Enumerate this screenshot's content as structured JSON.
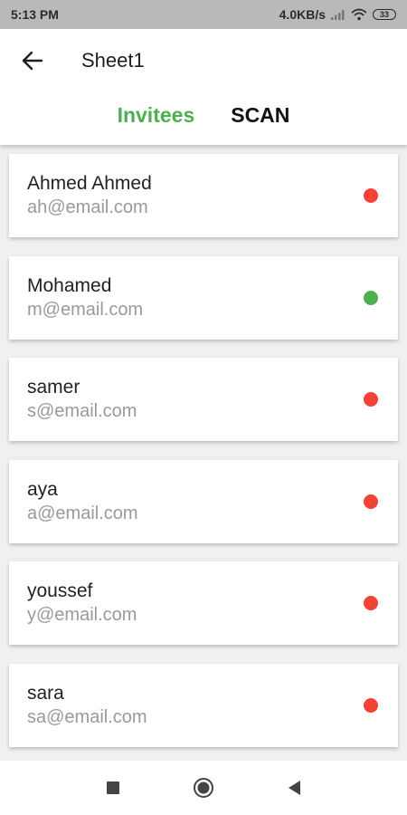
{
  "status_bar": {
    "time": "5:13 PM",
    "net_speed": "4.0KB/s",
    "battery": "33"
  },
  "header": {
    "title": "Sheet1",
    "tabs": [
      {
        "label": "Invitees",
        "active": true
      },
      {
        "label": "SCAN",
        "active": false
      }
    ]
  },
  "colors": {
    "active_tab": "#4caf50",
    "status_absent": "#f44336",
    "status_present": "#4caf50"
  },
  "invitees": [
    {
      "name": "Ahmed Ahmed",
      "email": "ah@email.com",
      "status": "absent"
    },
    {
      "name": "Mohamed",
      "email": "m@email.com",
      "status": "present"
    },
    {
      "name": "samer",
      "email": "s@email.com",
      "status": "absent"
    },
    {
      "name": "aya",
      "email": "a@email.com",
      "status": "absent"
    },
    {
      "name": "youssef",
      "email": "y@email.com",
      "status": "absent"
    },
    {
      "name": "sara",
      "email": "sa@email.com",
      "status": "absent"
    }
  ],
  "nav_bar": {
    "icons": [
      "recents-square-icon",
      "home-circle-icon",
      "back-triangle-icon"
    ]
  }
}
